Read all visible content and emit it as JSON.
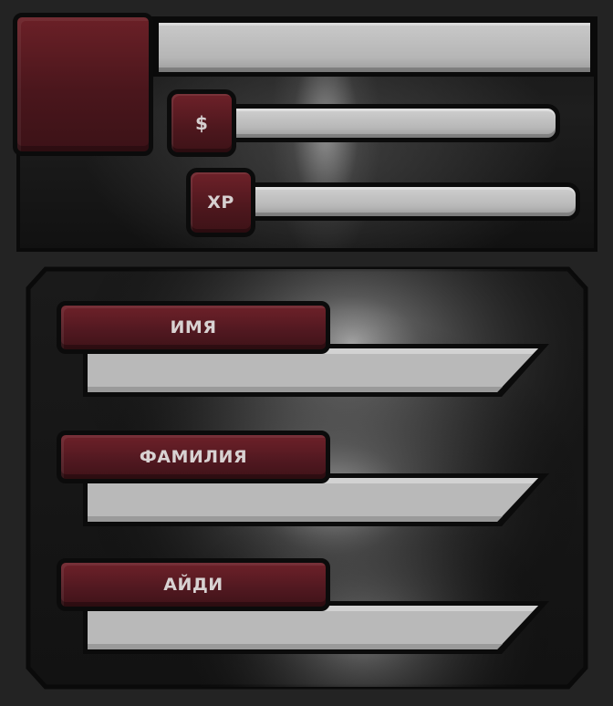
{
  "stats": {
    "money_label": "$",
    "xp_label": "XP"
  },
  "form": {
    "fields": [
      {
        "label": "ИМЯ",
        "value": ""
      },
      {
        "label": "ФАМИЛИЯ",
        "value": ""
      },
      {
        "label": "АЙДИ",
        "value": ""
      }
    ]
  },
  "colors": {
    "background": "#232323",
    "accent_red": "#5a1a20",
    "bar_grey": "#bdbdbd",
    "outline": "#0a0a0a"
  }
}
